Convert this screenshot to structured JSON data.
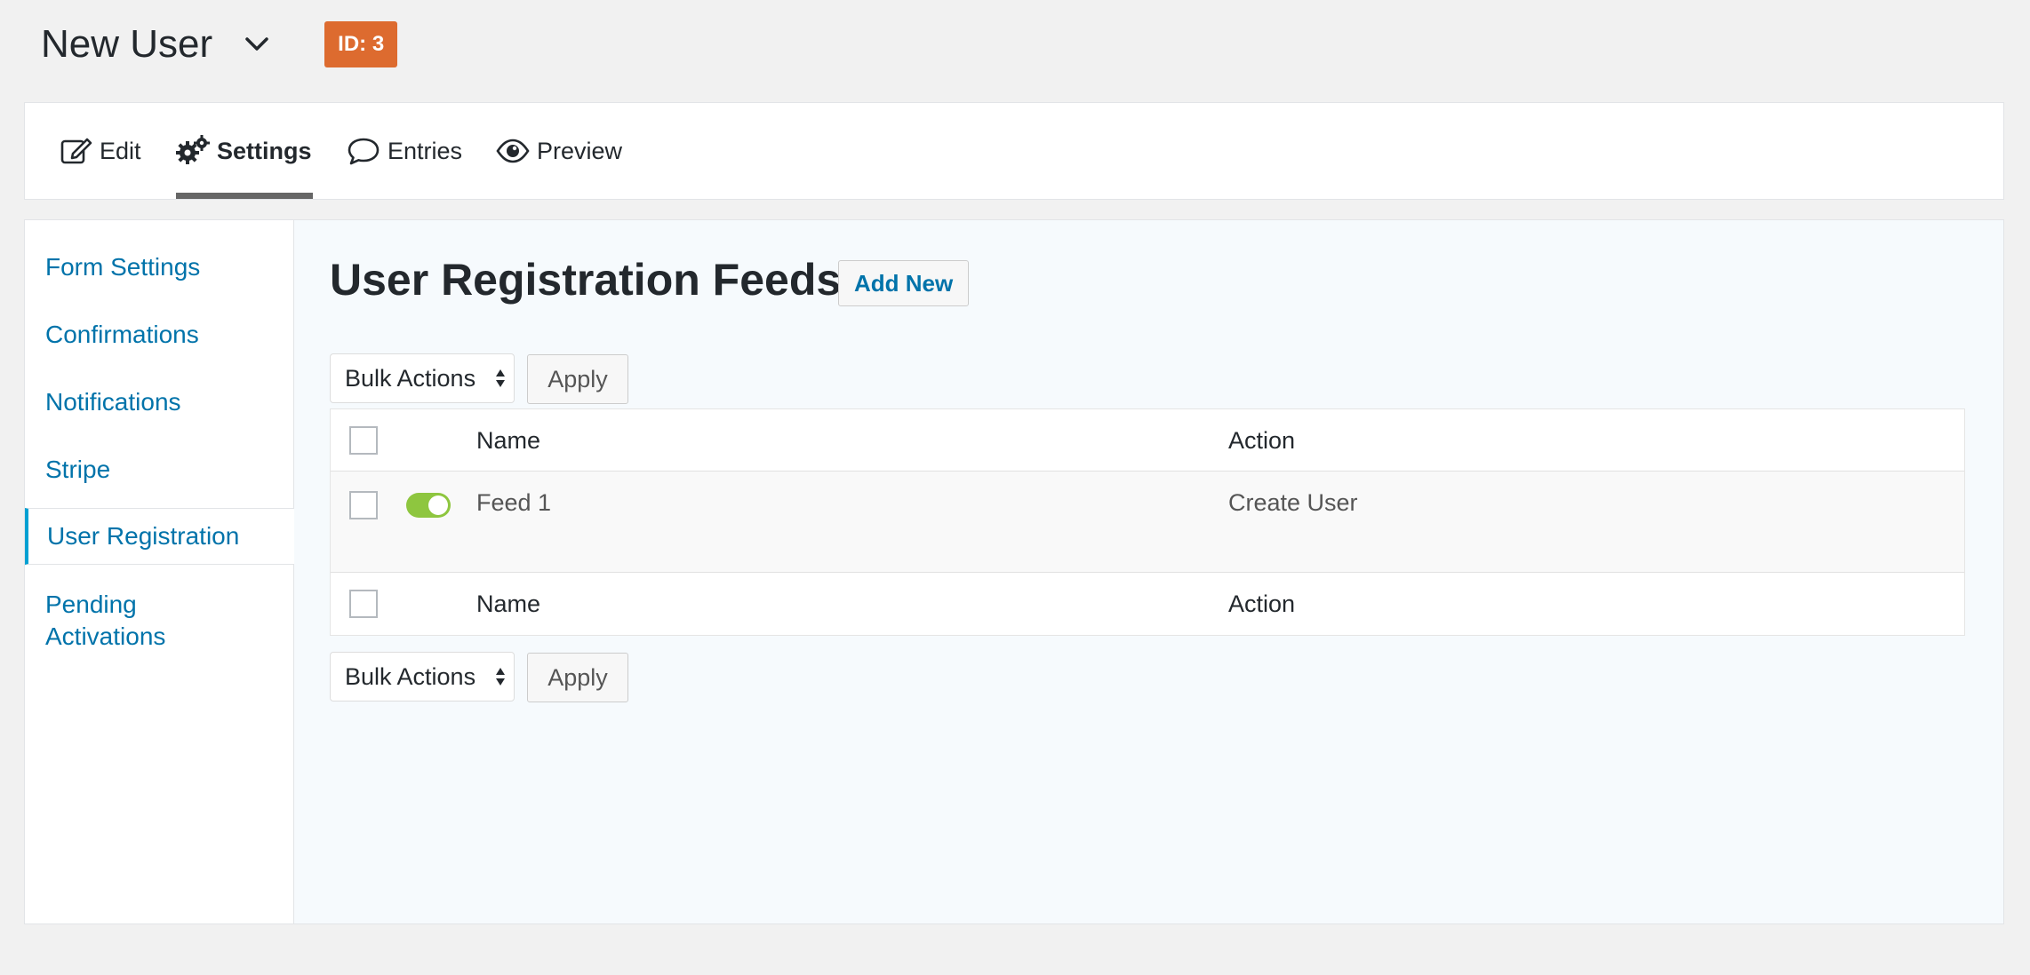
{
  "header": {
    "form_title": "New User",
    "id_badge": "ID: 3"
  },
  "tabs": [
    {
      "label": "Edit",
      "icon": "edit-icon"
    },
    {
      "label": "Settings",
      "icon": "gear-icon",
      "active": true
    },
    {
      "label": "Entries",
      "icon": "speech-bubble-icon"
    },
    {
      "label": "Preview",
      "icon": "eye-icon"
    }
  ],
  "sidebar": {
    "items": [
      {
        "label": "Form Settings"
      },
      {
        "label": "Confirmations"
      },
      {
        "label": "Notifications"
      },
      {
        "label": "Stripe"
      },
      {
        "label": "User Registration",
        "active": true
      },
      {
        "label": "Pending Activations"
      }
    ]
  },
  "content": {
    "title": "User Registration Feeds",
    "add_new_label": "Add New",
    "bulk_actions_label": "Bulk Actions",
    "apply_label": "Apply",
    "table": {
      "columns": [
        "Name",
        "Action"
      ],
      "rows": [
        {
          "name": "Feed 1",
          "action": "Create User",
          "active": true
        }
      ]
    }
  },
  "colors": {
    "link": "#0073aa",
    "badge": "#dd6b2f",
    "toggle_on": "#8ec63f",
    "active_tab_indicator": "#666666",
    "sidebar_active_border": "#00a0d2"
  }
}
